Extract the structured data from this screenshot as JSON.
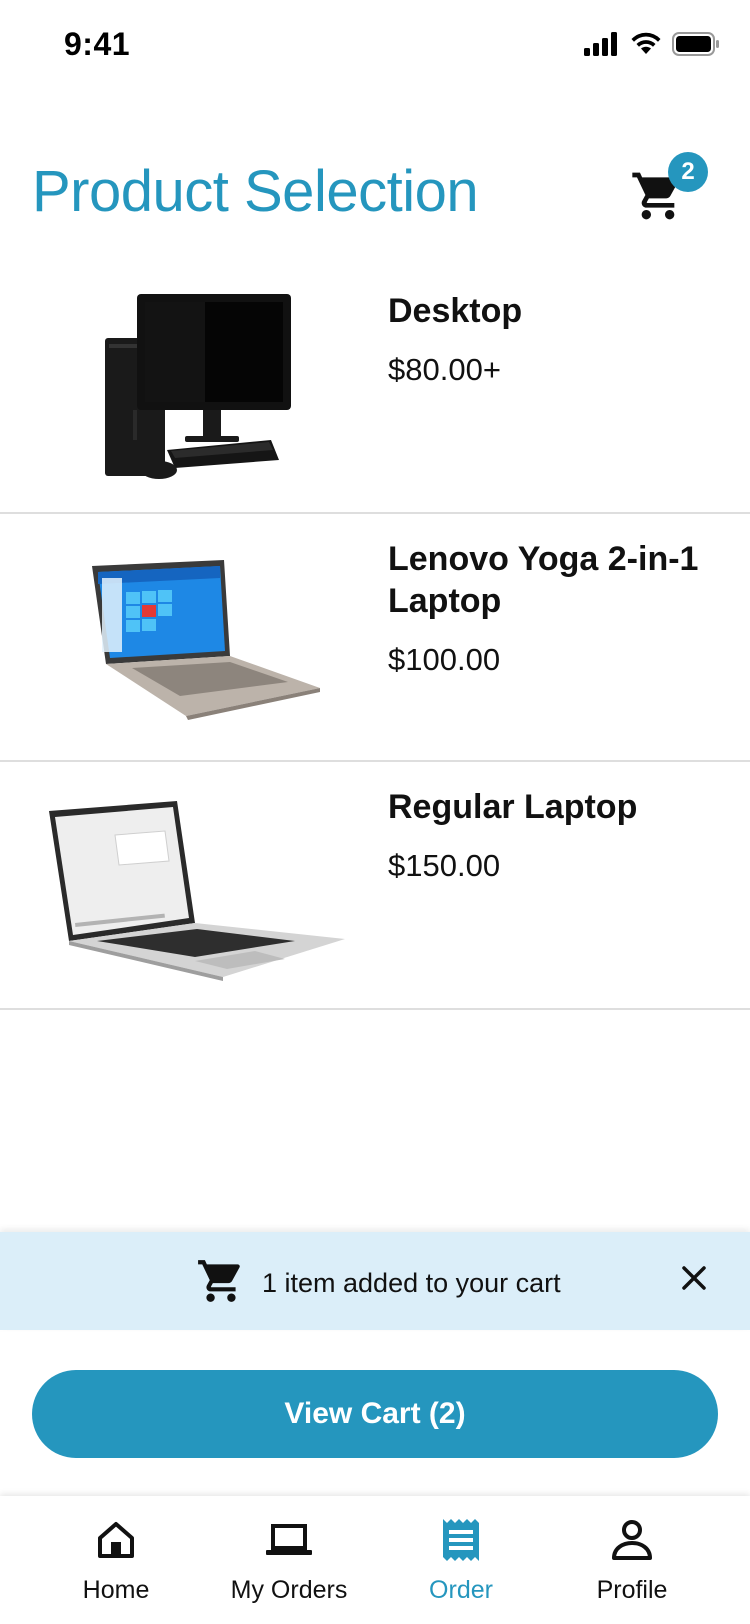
{
  "status_bar": {
    "time": "9:41",
    "icons": [
      "signal-icon",
      "wifi-icon",
      "battery-icon"
    ]
  },
  "header": {
    "title": "Product Selection",
    "cart_count": "2",
    "cart_icon": "cart-icon"
  },
  "products": [
    {
      "name": "Desktop",
      "price": "$80.00+",
      "image": "desktop-computer"
    },
    {
      "name": "Lenovo Yoga 2-in-1 Laptop",
      "price": "$100.00",
      "image": "convertible-laptop"
    },
    {
      "name": "Regular Laptop",
      "price": "$150.00",
      "image": "laptop"
    }
  ],
  "toast": {
    "message": "1 item added to your cart",
    "icon": "cart-icon",
    "close_icon": "close-icon"
  },
  "view_cart": {
    "label": "View Cart (2)"
  },
  "tabs": [
    {
      "label": "Home",
      "icon": "home-icon",
      "active": false
    },
    {
      "label": "My Orders",
      "icon": "laptop-icon",
      "active": false
    },
    {
      "label": "Order",
      "icon": "receipt-icon",
      "active": true
    },
    {
      "label": "Profile",
      "icon": "person-icon",
      "active": false
    }
  ],
  "colors": {
    "accent": "#2596be",
    "toast_bg": "#dbeef9",
    "divider": "#dedede"
  }
}
